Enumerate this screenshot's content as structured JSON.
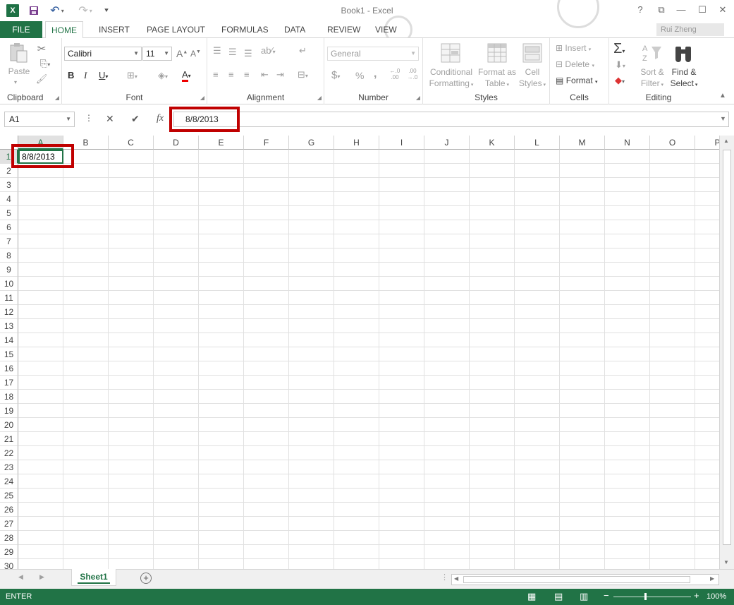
{
  "app": {
    "title": "Book1 - Excel",
    "logo_letter": "X"
  },
  "titlebar": {
    "help": "?",
    "ribbon_display": "⧉",
    "minimize": "—",
    "maximize": "☐",
    "close": "✕",
    "signin": "Rui Zheng"
  },
  "tabs": {
    "file": "FILE",
    "items": [
      "HOME",
      "INSERT",
      "PAGE LAYOUT",
      "FORMULAS",
      "DATA",
      "REVIEW",
      "VIEW"
    ],
    "active": "HOME"
  },
  "ribbon": {
    "clipboard": {
      "paste": "Paste",
      "label": "Clipboard"
    },
    "font": {
      "family": "Calibri",
      "size": "11",
      "bold": "B",
      "italic": "I",
      "underline": "U",
      "grow": "A",
      "shrink": "A",
      "font_color_letter": "A",
      "label": "Font"
    },
    "alignment": {
      "label": "Alignment"
    },
    "number": {
      "format": "General",
      "currency": "$",
      "percent": "%",
      "comma": ",",
      "inc_decimal": "←.0 .00",
      "dec_decimal": ".00 →.0",
      "label": "Number"
    },
    "styles": {
      "conditional_1": "Conditional",
      "conditional_2": "Formatting",
      "table_1": "Format as",
      "table_2": "Table",
      "cell_1": "Cell",
      "cell_2": "Styles",
      "label": "Styles"
    },
    "cells": {
      "insert": "Insert",
      "delete": "Delete",
      "format": "Format",
      "label": "Cells"
    },
    "editing": {
      "sort_1": "Sort &",
      "sort_2": "Filter",
      "find_1": "Find &",
      "find_2": "Select",
      "label": "Editing"
    }
  },
  "formula_bar": {
    "name_box": "A1",
    "cancel": "✕",
    "enter": "✔",
    "fx": "fx",
    "value": "8/8/2013"
  },
  "grid": {
    "columns": [
      "A",
      "B",
      "C",
      "D",
      "E",
      "F",
      "G",
      "H",
      "I",
      "J",
      "K",
      "L",
      "M",
      "N",
      "O",
      "P"
    ],
    "rows": [
      "1",
      "2",
      "3",
      "4",
      "5",
      "6",
      "7",
      "8",
      "9",
      "10",
      "11",
      "12",
      "13",
      "14",
      "15",
      "16",
      "17",
      "18",
      "19",
      "20",
      "21",
      "22",
      "23",
      "24",
      "25",
      "26",
      "27",
      "28",
      "29",
      "30"
    ],
    "active_cell": "A1",
    "a1_value": "8/8/2013"
  },
  "sheets": {
    "tabs": [
      "Sheet1"
    ],
    "add": "+"
  },
  "status": {
    "mode": "ENTER",
    "zoom": "100%"
  },
  "colors": {
    "accent": "#217346",
    "highlight": "#c00000"
  }
}
